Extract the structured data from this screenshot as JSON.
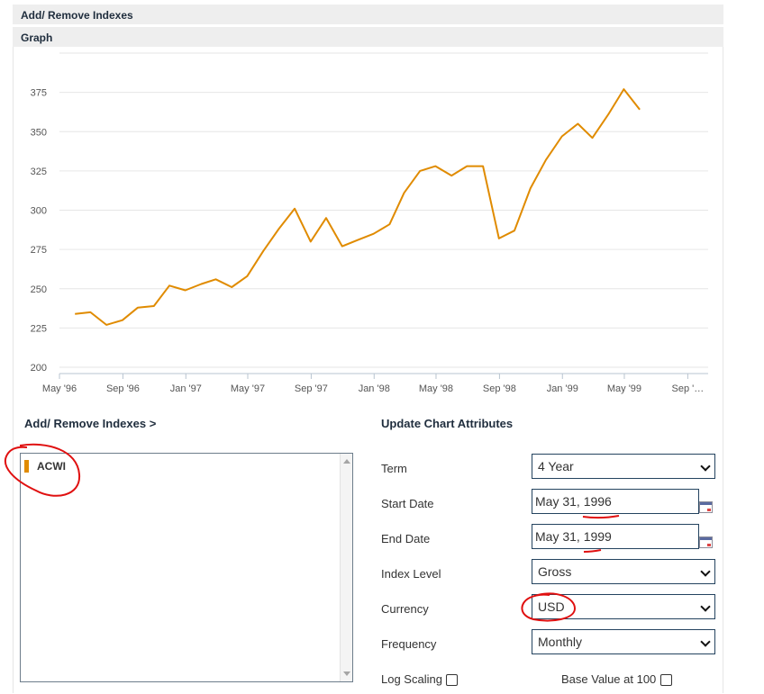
{
  "sections": {
    "add_remove_bar": "Add/ Remove Indexes",
    "graph_bar": "Graph"
  },
  "chart_data": {
    "type": "line",
    "y_ticks": [
      "200",
      "225",
      "250",
      "275",
      "300",
      "325",
      "350",
      "375"
    ],
    "x_ticks": [
      "May '96",
      "Sep '96",
      "Jan '97",
      "May '97",
      "Sep '97",
      "Jan '98",
      "May '98",
      "Sep '98",
      "Jan '99",
      "May '99",
      "Sep '…"
    ],
    "ylim": [
      196,
      400
    ],
    "series": [
      {
        "name": "ACWI",
        "color": "#e08b00",
        "x": [
          "1996-05-31",
          "1996-06-30",
          "1996-07-31",
          "1996-08-31",
          "1996-09-30",
          "1996-10-31",
          "1996-11-30",
          "1996-12-31",
          "1997-01-31",
          "1997-02-28",
          "1997-03-31",
          "1997-04-30",
          "1997-05-31",
          "1997-06-30",
          "1997-07-31",
          "1997-08-31",
          "1997-09-30",
          "1997-10-31",
          "1997-11-30",
          "1997-12-31",
          "1998-01-31",
          "1998-02-28",
          "1998-03-31",
          "1998-04-30",
          "1998-05-31",
          "1998-06-30",
          "1998-07-31",
          "1998-08-31",
          "1998-09-30",
          "1998-10-31",
          "1998-11-30",
          "1998-12-31",
          "1999-01-31",
          "1999-02-28",
          "1999-03-31",
          "1999-04-30",
          "1999-05-31"
        ],
        "values": [
          234,
          235,
          227,
          230,
          238,
          239,
          252,
          249,
          253,
          256,
          251,
          258,
          274,
          288,
          301,
          280,
          295,
          277,
          281,
          285,
          291,
          311,
          325,
          328,
          322,
          328,
          328,
          282,
          287,
          314,
          332,
          347,
          355,
          346,
          361,
          377,
          364
        ]
      }
    ],
    "grid": true
  },
  "indexes_panel": {
    "title": "Add/ Remove Indexes >",
    "items": [
      {
        "label": "ACWI",
        "color": "#e08b00"
      }
    ]
  },
  "attributes": {
    "title": "Update Chart Attributes",
    "term_label": "Term",
    "term_value": "4 Year",
    "start_label": "Start Date",
    "start_value": "May 31, 1996",
    "end_label": "End Date",
    "end_value": "May 31, 1999",
    "index_level_label": "Index Level",
    "index_level_value": "Gross",
    "currency_label": "Currency",
    "currency_value": "USD",
    "frequency_label": "Frequency",
    "frequency_value": "Monthly",
    "log_scaling_label": "Log Scaling",
    "log_scaling_checked": false,
    "base_value_label": "Base Value at 100",
    "base_value_checked": false
  },
  "annotation_color": "#e01010"
}
